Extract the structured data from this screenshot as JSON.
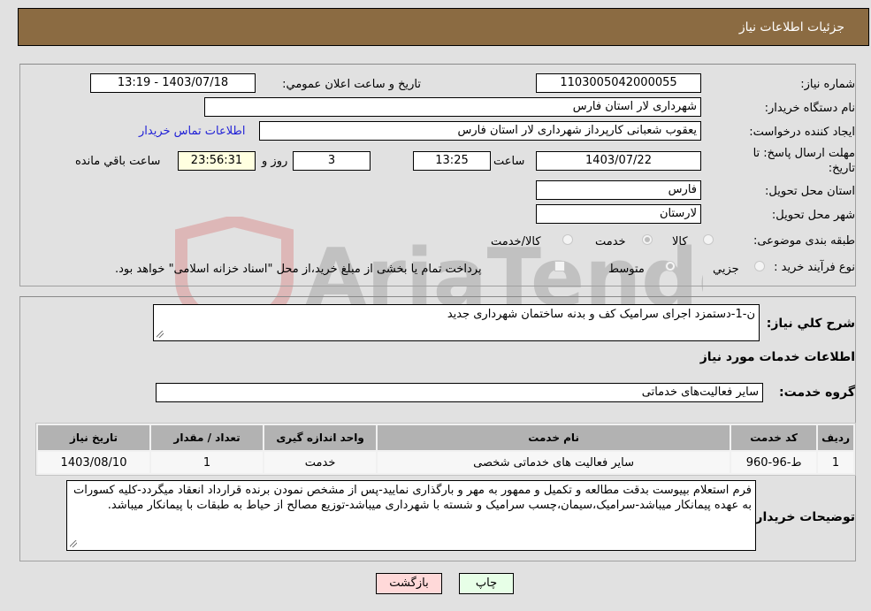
{
  "header": {
    "title": "جزئیات اطلاعات نیاز"
  },
  "details": {
    "need_number_label": "شماره نیاز:",
    "need_number": "1103005042000055",
    "announce_label": "تاریخ و ساعت اعلان عمومي:",
    "announce_value": "1403/07/18 - 13:19",
    "buyer_org_label": "نام دستگاه خريدار:",
    "buyer_org": "شهرداری لار استان فارس",
    "creator_label": "ايجاد کننده درخواست:",
    "creator": "یعقوب شعبانی کارپرداز شهرداری لار استان فارس",
    "contact_link": "اطلاعات تماس خریدار",
    "deadline_label_line1": "مهلت ارسال پاسخ: تا",
    "deadline_label_line2": "تاريخ:",
    "deadline_date": "1403/07/22",
    "time_label": "ساعت",
    "deadline_time": "13:25",
    "days_value": "3",
    "days_label": "روز و",
    "remaining_time": "23:56:31",
    "remaining_label": "ساعت باقي مانده",
    "province_label": "استان محل تحویل:",
    "province": "فارس",
    "city_label": "شهر محل تحویل:",
    "city": "لارستان",
    "category_label": "طبقه بندی موضوعی:",
    "category_options": [
      {
        "label": "کالا",
        "checked": false
      },
      {
        "label": "خدمت",
        "checked": true
      },
      {
        "label": "کالا/خدمت",
        "checked": false
      }
    ],
    "process_label": "نوع فرآيند خريد :",
    "process_options": [
      {
        "label": "جزيي",
        "checked": false
      },
      {
        "label": "متوسط",
        "checked": true
      }
    ],
    "treasury_checkbox_label": "پرداخت تمام یا بخشی از مبلغ خرید،از محل \"اسناد خزانه اسلامی\" خواهد بود.",
    "treasury_checked": false
  },
  "description": {
    "label": "شرح کلي نياز:",
    "value": "ن-1-دستمزد اجرای سرامیک کف و بدنه ساختمان شهرداری جدید"
  },
  "services": {
    "section_title": "اطلاعات خدمات مورد نياز",
    "group_label": "گروه خدمت:",
    "group_value": "سایر فعالیت‌های خدماتی",
    "columns": [
      "رديف",
      "کد خدمت",
      "نام خدمت",
      "واحد اندازه گيری",
      "تعداد / مقدار",
      "تاريخ نياز"
    ],
    "rows": [
      [
        "1",
        "ط-96-960",
        "سایر فعالیت های خدماتی شخصی",
        "خدمت",
        "1",
        "1403/08/10"
      ]
    ]
  },
  "buyer_notes": {
    "label": "توضیحات خریدار:",
    "value": "فرم استعلام بپیوست بدقت مطالعه و تکمیل و ممهور به مهر و بارگذاری نمایید-پس از مشخص نمودن برنده قرارداد انعقاد میگردد-کلیه کسورات به عهده پیمانکار میباشد-سرامیک،سیمان،چسب سرامیک و شسته با شهرداری میباشد-توزیع مصالح از حیاط به طبقات با پیمانکار میباشد."
  },
  "buttons": {
    "print": "چاپ",
    "back": "بازگشت"
  },
  "watermark": {
    "text": "AriaTender.neT"
  },
  "colors": {
    "header_bg": "#8b6b42",
    "back_bg": "#ffd9d9",
    "print_bg": "#e7ffe7",
    "remaining_bg": "#ffffe0",
    "link": "#1f1fd6"
  }
}
